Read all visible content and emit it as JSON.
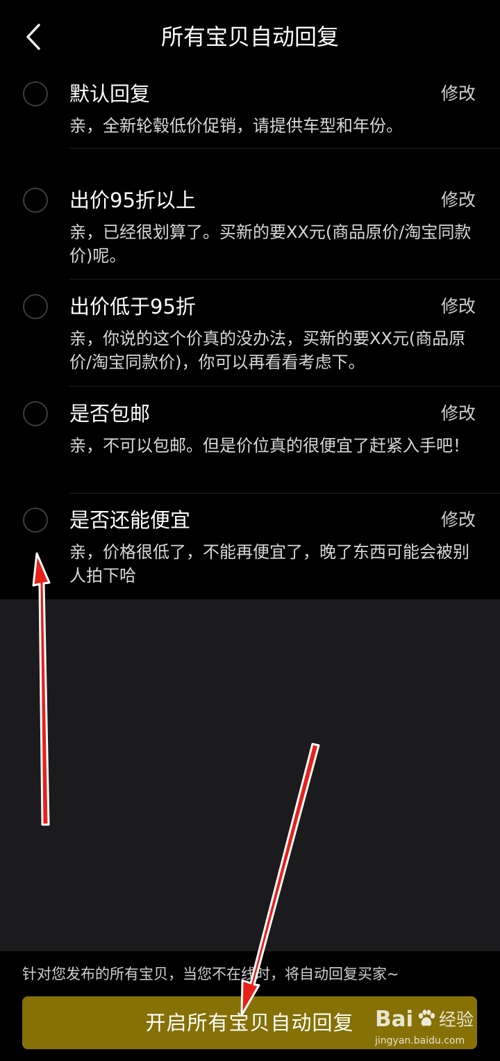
{
  "header": {
    "title": "所有宝贝自动回复",
    "back_icon": "chevron-left-icon"
  },
  "replies": [
    {
      "title": "默认回复",
      "edit_label": "修改",
      "text": "亲，全新轮毂低价促销，请提供车型和年份。"
    },
    {
      "title": "出价95折以上",
      "edit_label": "修改",
      "text": "亲，已经很划算了。买新的要XX元(商品原价/淘宝同款价)呢。"
    },
    {
      "title": "出价低于95折",
      "edit_label": "修改",
      "text": "亲，你说的这个价真的没办法，买新的要XX元(商品原价/淘宝同款价)，你可以再看看考虑下。"
    },
    {
      "title": "是否包邮",
      "edit_label": "修改",
      "text": "亲，不可以包邮。但是价位真的很便宜了赶紧入手吧！"
    },
    {
      "title": "是否还能便宜",
      "edit_label": "修改",
      "text": "亲，价格很低了，不能再便宜了，晚了东西可能会被别人拍下哈"
    }
  ],
  "footer": {
    "note": "针对您发布的所有宝贝，当您不在线时，将自动回复买家~",
    "button_label": "开启所有宝贝自动回复"
  },
  "watermark": {
    "brand": "Bai",
    "brand_suffix": "经验",
    "url": "jingyan.baidu.com"
  },
  "colors": {
    "background": "#000000",
    "empty_area": "#1b1b1e",
    "button": "#857106",
    "annotation_arrow": "#e8201a"
  }
}
